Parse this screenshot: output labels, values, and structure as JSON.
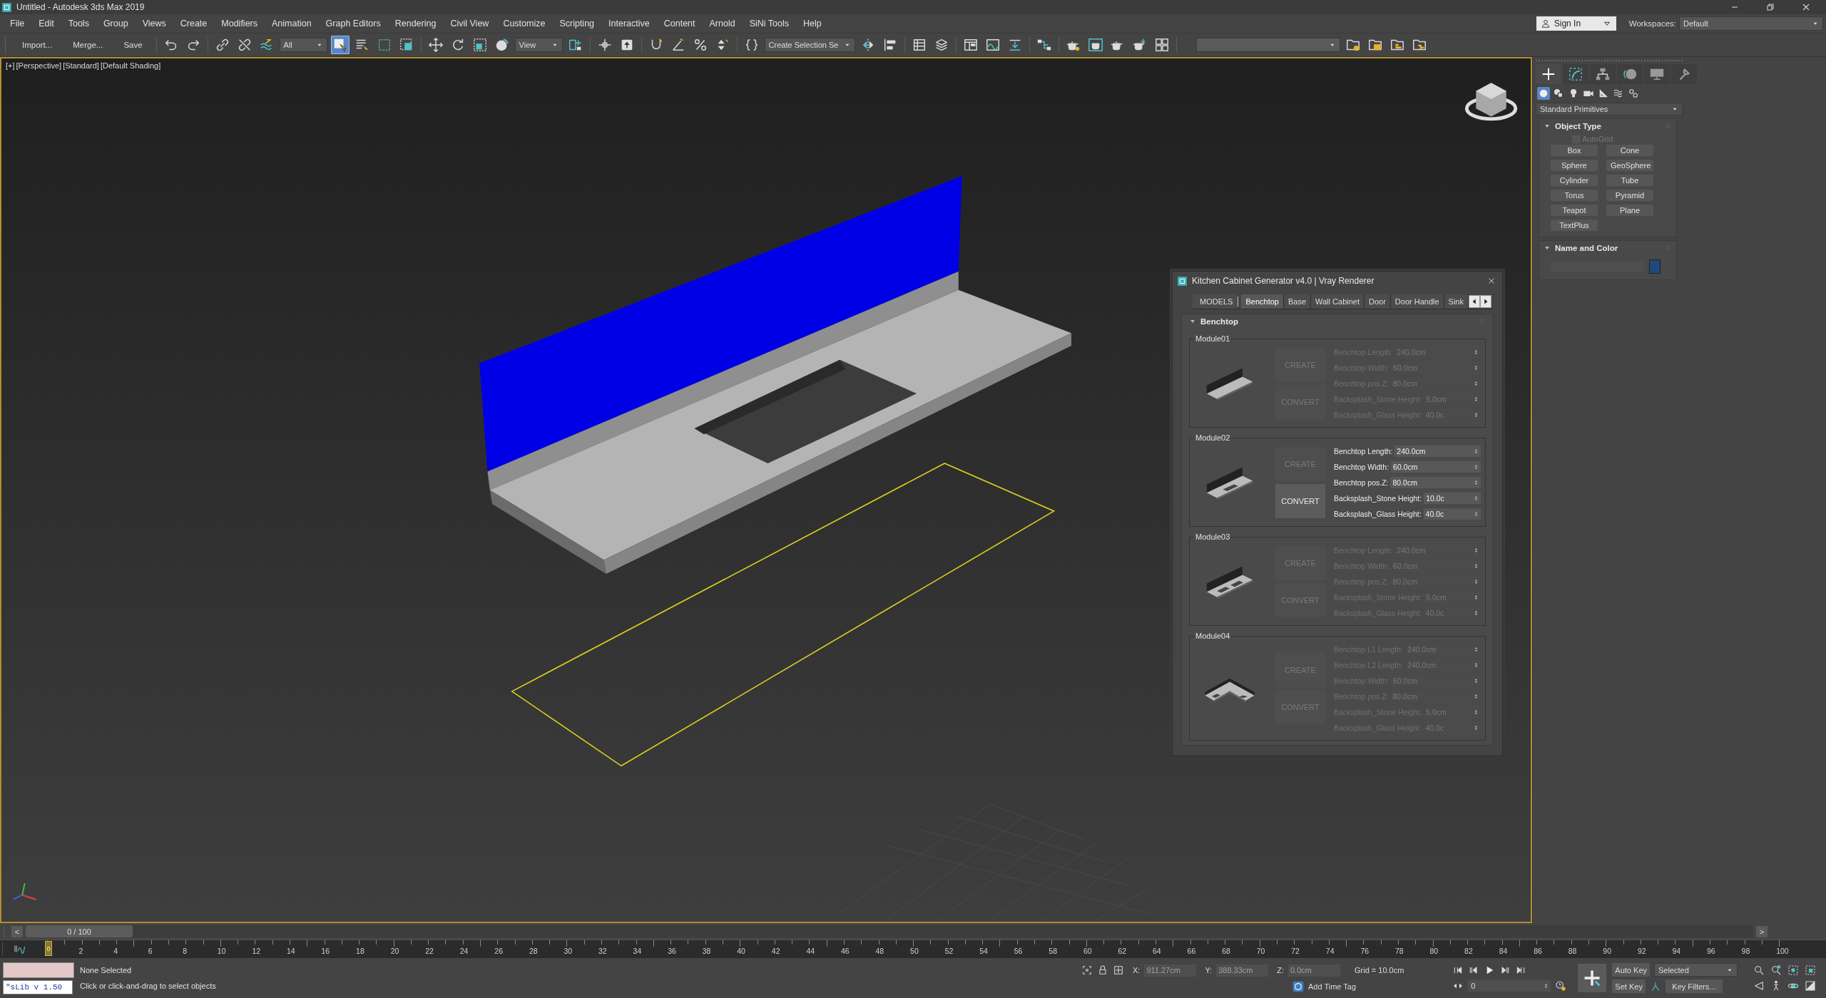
{
  "window": {
    "title": "Untitled - Autodesk 3ds Max 2019"
  },
  "menu": [
    "File",
    "Edit",
    "Tools",
    "Group",
    "Views",
    "Create",
    "Modifiers",
    "Animation",
    "Graph Editors",
    "Rendering",
    "Civil View",
    "Customize",
    "Scripting",
    "Interactive",
    "Content",
    "Arnold",
    "SiNi Tools",
    "Help"
  ],
  "account": {
    "label": "Sign In"
  },
  "workspaces": {
    "label": "Workspaces:",
    "value": "Default"
  },
  "toolbar": [
    {
      "kind": "text",
      "label": "Import..."
    },
    {
      "kind": "text",
      "label": "Merge..."
    },
    {
      "kind": "text",
      "label": "Save"
    },
    {
      "kind": "sep"
    },
    {
      "kind": "undo",
      "selected": false
    },
    {
      "kind": "redo",
      "selected": false
    },
    {
      "kind": "sep"
    },
    {
      "kind": "link",
      "selected": false
    },
    {
      "kind": "unlink",
      "selected": false
    },
    {
      "kind": "bind",
      "selected": false
    },
    {
      "kind": "dropdown",
      "value": "All"
    },
    {
      "kind": "select",
      "selected": true
    },
    {
      "kind": "list",
      "selected": false
    },
    {
      "kind": "rect",
      "selected": false
    },
    {
      "kind": "window",
      "selected": false
    },
    {
      "kind": "sep"
    },
    {
      "kind": "move",
      "selected": false
    },
    {
      "kind": "rotate",
      "selected": false
    },
    {
      "kind": "scale",
      "selected": false
    },
    {
      "kind": "sphere",
      "selected": false
    },
    {
      "kind": "dropdown",
      "value": "View"
    },
    {
      "kind": "pivot",
      "selected": false
    },
    {
      "kind": "sep"
    },
    {
      "kind": "cross",
      "selected": false
    },
    {
      "kind": "place",
      "selected": false
    },
    {
      "kind": "sep"
    },
    {
      "kind": "snap",
      "selected": false
    },
    {
      "kind": "angle",
      "selected": false
    },
    {
      "kind": "percent",
      "selected": false
    },
    {
      "kind": "spinner",
      "selected": false
    },
    {
      "kind": "sep"
    },
    {
      "kind": "braces",
      "selected": false
    },
    {
      "kind": "dropdown",
      "value": "Create Selection Se"
    },
    {
      "kind": "mirror",
      "selected": false
    },
    {
      "kind": "align",
      "selected": false
    },
    {
      "kind": "sep"
    },
    {
      "kind": "table",
      "selected": false
    },
    {
      "kind": "layers",
      "selected": false
    },
    {
      "kind": "sep"
    },
    {
      "kind": "panels",
      "selected": false
    },
    {
      "kind": "curve",
      "selected": false
    },
    {
      "kind": "download",
      "selected": false
    },
    {
      "kind": "sep"
    },
    {
      "kind": "schematic",
      "selected": false
    },
    {
      "kind": "sep"
    },
    {
      "kind": "teapot_gear",
      "selected": false
    },
    {
      "kind": "teapot_frame",
      "selected": false
    },
    {
      "kind": "teapot",
      "selected": false
    },
    {
      "kind": "teapot_arrow",
      "selected": false
    },
    {
      "kind": "grid4",
      "selected": false
    },
    {
      "kind": "sep"
    },
    {
      "kind": "dropdown"
    },
    {
      "kind": "folder_gear",
      "selected": false
    },
    {
      "kind": "folder",
      "selected": false
    },
    {
      "kind": "folder_tree",
      "selected": false
    },
    {
      "kind": "folder_net",
      "selected": false
    }
  ],
  "viewport": {
    "labels": [
      "[+]",
      "[Perspective]",
      "[Standard]",
      "[Default Shading]"
    ]
  },
  "dialog": {
    "title": "Kitchen Cabinet Generator v4.0 | Vray Renderer",
    "models_label": "MODELS",
    "tabs": [
      {
        "label": "Benchtop",
        "selected": true
      },
      {
        "label": "Base",
        "selected": false
      },
      {
        "label": "Wall Cabinet",
        "selected": false
      },
      {
        "label": "Door",
        "selected": false
      },
      {
        "label": "Door Handle",
        "selected": false
      },
      {
        "label": "Sink",
        "selected": false
      }
    ],
    "rollout": "Benchtop",
    "modules": [
      {
        "title": "Module01",
        "kind": "straight",
        "buttons": [
          {
            "label": "CREATE",
            "disabled": true
          },
          {
            "label": "CONVERT",
            "disabled": true
          }
        ],
        "fields": [
          {
            "label": "Benchtop Length:",
            "value": "240.0cm",
            "disabled": true
          },
          {
            "label": "Benchtop Width:",
            "value": "60.0cm",
            "disabled": true
          },
          {
            "label": "Benchtop pos.Z:",
            "value": "80.0cm",
            "disabled": true
          },
          {
            "label": "Backsplash_Stone Height:",
            "value": "5.0cm",
            "disabled": true
          },
          {
            "label": "Backsplash_Glass Height:",
            "value": "40.0c",
            "disabled": true
          }
        ]
      },
      {
        "title": "Module02",
        "kind": "one_sink",
        "buttons": [
          {
            "label": "CREATE",
            "disabled": true
          },
          {
            "label": "CONVERT",
            "disabled": false
          }
        ],
        "fields": [
          {
            "label": "Benchtop Length:",
            "value": "240.0cm",
            "disabled": false
          },
          {
            "label": "Benchtop Width:",
            "value": "60.0cm",
            "disabled": false
          },
          {
            "label": "Benchtop pos.Z:",
            "value": "80.0cm",
            "disabled": false
          },
          {
            "label": "Backsplash_Stone Height:",
            "value": "10.0c",
            "disabled": false
          },
          {
            "label": "Backsplash_Glass Height:",
            "value": "40.0c",
            "disabled": false
          }
        ]
      },
      {
        "title": "Module03",
        "kind": "two_sinks",
        "buttons": [
          {
            "label": "CREATE",
            "disabled": true
          },
          {
            "label": "CONVERT",
            "disabled": true
          }
        ],
        "fields": [
          {
            "label": "Benchtop Length:",
            "value": "240.0cm",
            "disabled": true
          },
          {
            "label": "Benchtop Width:",
            "value": "60.0cm",
            "disabled": true
          },
          {
            "label": "Benchtop pos.Z:",
            "value": "80.0cm",
            "disabled": true
          },
          {
            "label": "Backsplash_Stone Height:",
            "value": "5.0cm",
            "disabled": true
          },
          {
            "label": "Backsplash_Glass Height:",
            "value": "40.0c",
            "disabled": true
          }
        ]
      },
      {
        "title": "Module04",
        "kind": "corner",
        "buttons": [
          {
            "label": "CREATE",
            "disabled": true
          },
          {
            "label": "CONVERT",
            "disabled": true
          }
        ],
        "fields": [
          {
            "label": "Benchtop L1 Length:",
            "value": "240.0cm",
            "disabled": true
          },
          {
            "label": "Benchtop L2 Length:",
            "value": "240.0cm",
            "disabled": true
          },
          {
            "label": "Benchtop Width:",
            "value": "60.0cm",
            "disabled": true
          },
          {
            "label": "Benchtop pos.Z:",
            "value": "80.0cm",
            "disabled": true
          },
          {
            "label": "Backsplash_Stone Height:",
            "value": "5.0cm",
            "disabled": true
          },
          {
            "label": "Backsplash_Glass Height:",
            "value": "40.0c",
            "disabled": true
          }
        ]
      }
    ]
  },
  "command_panel": {
    "tabs": [
      {
        "kind": "create",
        "selected": true
      },
      {
        "kind": "modify",
        "selected": false
      },
      {
        "kind": "hierarchy",
        "selected": false
      },
      {
        "kind": "motion",
        "selected": false
      },
      {
        "kind": "display",
        "selected": false
      },
      {
        "kind": "utilities",
        "selected": false
      }
    ],
    "categories": [
      {
        "kind": "geometry",
        "selected": true
      },
      {
        "kind": "shapes",
        "selected": false
      },
      {
        "kind": "lights",
        "selected": false
      },
      {
        "kind": "cameras",
        "selected": false
      },
      {
        "kind": "helpers",
        "selected": false
      },
      {
        "kind": "spacewarps",
        "selected": false
      },
      {
        "kind": "systems",
        "selected": false
      }
    ],
    "dropdown": "Standard Primitives",
    "object_type": {
      "title": "Object Type",
      "autogrid": {
        "label": "AutoGrid",
        "checked": false,
        "disabled": true
      },
      "buttons": [
        "Box",
        "Cone",
        "Sphere",
        "GeoSphere",
        "Cylinder",
        "Tube",
        "Torus",
        "Pyramid",
        "Teapot",
        "Plane",
        "TextPlus"
      ]
    },
    "name_color": {
      "title": "Name and Color",
      "color": "#1f4a78"
    }
  },
  "time_slider": {
    "prev": "<",
    "value": "0 / 100",
    "next": ">",
    "level": 0
  },
  "track": {
    "current": "0",
    "ticks": [
      "2",
      "4",
      "6",
      "8",
      "10",
      "12",
      "14",
      "16",
      "18",
      "20",
      "22",
      "24",
      "26",
      "28",
      "30",
      "32",
      "34",
      "36",
      "38",
      "40",
      "42",
      "44",
      "46",
      "48",
      "50",
      "52",
      "54",
      "56",
      "58",
      "60",
      "62",
      "64",
      "66",
      "68",
      "70",
      "72",
      "74",
      "76",
      "78",
      "80",
      "82",
      "84",
      "86",
      "88",
      "90",
      "92",
      "94",
      "96",
      "98",
      "100"
    ]
  },
  "status": {
    "script": "\"sLib v 1.50",
    "selection": "None Selected",
    "prompt": "Click or click-and-drag to select objects",
    "coords": [
      {
        "label": "X:",
        "value": "911.27cm"
      },
      {
        "label": "Y:",
        "value": "388.33cm"
      },
      {
        "label": "Z:",
        "value": "0.0cm"
      }
    ],
    "grid": "Grid = 10.0cm",
    "time_tag": "Add Time Tag",
    "frame": "0",
    "auto_key": "Auto Key",
    "key_mode": "Selected",
    "set_key": "Set Key",
    "key_filters": "Key Filters..."
  }
}
